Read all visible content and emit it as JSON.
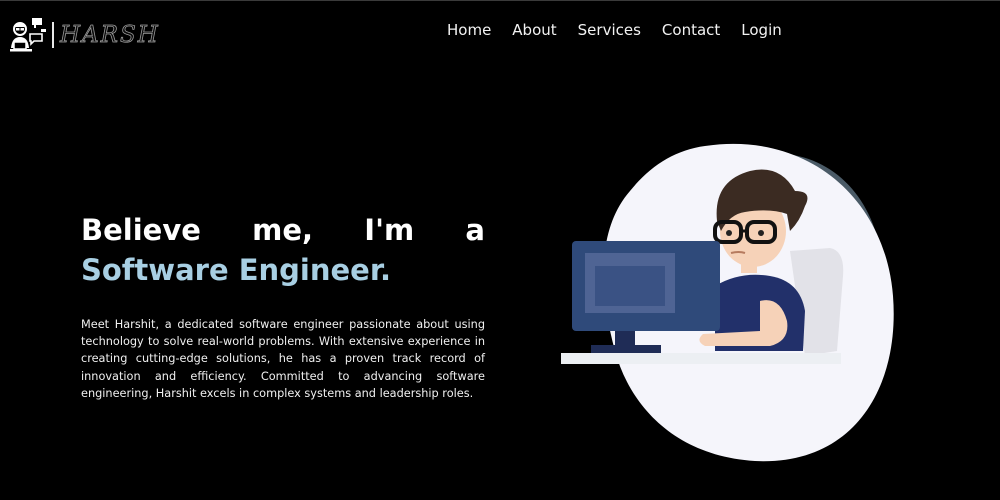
{
  "header": {
    "logo_text": "HARSH",
    "nav": [
      "Home",
      "About",
      "Services",
      "Contact",
      "Login"
    ]
  },
  "hero": {
    "words": [
      "Believe",
      "me,",
      "I'm",
      "a"
    ],
    "highlight": "Software Engineer.",
    "description": "Meet Harshit, a dedicated software engineer passionate about using technology to solve real-world problems. With extensive experience in creating cutting-edge solutions, he has a proven track record of innovation and efficiency. Committed to advancing software engineering, Harshit excels in complex systems and leadership roles."
  },
  "colors": {
    "background": "#000000",
    "accent": "#a8cfe3",
    "blob": "#f5f5fb",
    "shadow": "#4a5a66",
    "monitor": "#2f4a7a"
  },
  "icons": {
    "logo": "developer-at-desk-icon",
    "illustration": "programmer-at-computer-illustration"
  }
}
